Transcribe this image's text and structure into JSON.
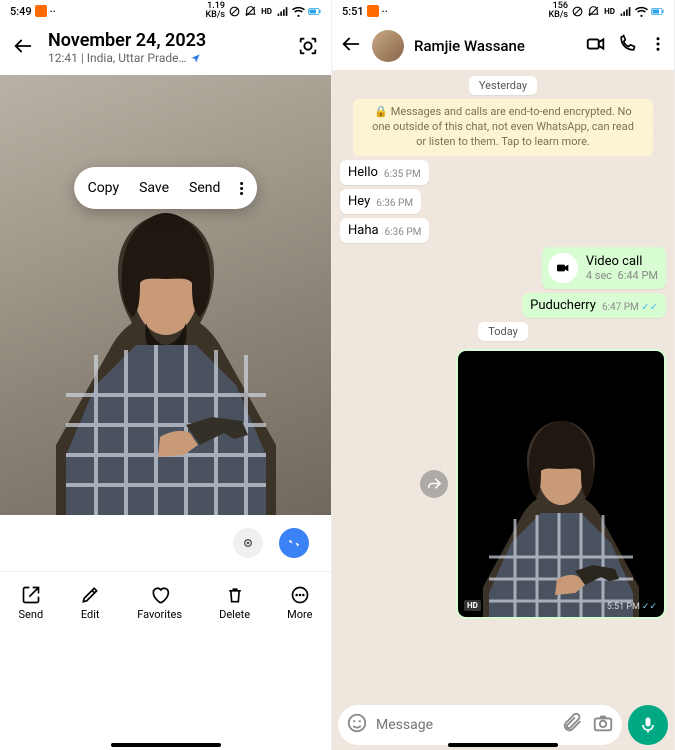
{
  "left": {
    "statusbar": {
      "time": "5:49",
      "kbs": "1.19\nKB/s"
    },
    "header": {
      "title": "November 24, 2023",
      "subtitle": "12:41 | India, Uttar Prade…"
    },
    "popup": {
      "copy": "Copy",
      "save": "Save",
      "send": "Send"
    },
    "toolbar": [
      {
        "id": "send",
        "label": "Send"
      },
      {
        "id": "edit",
        "label": "Edit"
      },
      {
        "id": "favorites",
        "label": "Favorites"
      },
      {
        "id": "delete",
        "label": "Delete"
      },
      {
        "id": "more",
        "label": "More"
      }
    ]
  },
  "right": {
    "statusbar": {
      "time": "5:51",
      "kbs": "156\nKB/s"
    },
    "header": {
      "name": "Ramjie Wassane"
    },
    "yesterday_label": "Yesterday",
    "encryption": "🔒 Messages and calls are end-to-end encrypted. No one outside of this chat, not even WhatsApp, can read or listen to them. Tap to learn more.",
    "messages": [
      {
        "dir": "in",
        "text": "Hello",
        "time": "6:35 PM"
      },
      {
        "dir": "in",
        "text": "Hey",
        "time": "6:36 PM"
      },
      {
        "dir": "in",
        "text": "Haha",
        "time": "6:36 PM"
      }
    ],
    "video_call": {
      "title": "Video call",
      "sub": "4 sec",
      "time": "6:44 PM"
    },
    "out_msg": {
      "text": "Puducherry",
      "time": "6:47 PM"
    },
    "today_label": "Today",
    "sticker": {
      "hd": "HD",
      "time": "5:51 PM"
    },
    "input": {
      "placeholder": "Message"
    }
  }
}
